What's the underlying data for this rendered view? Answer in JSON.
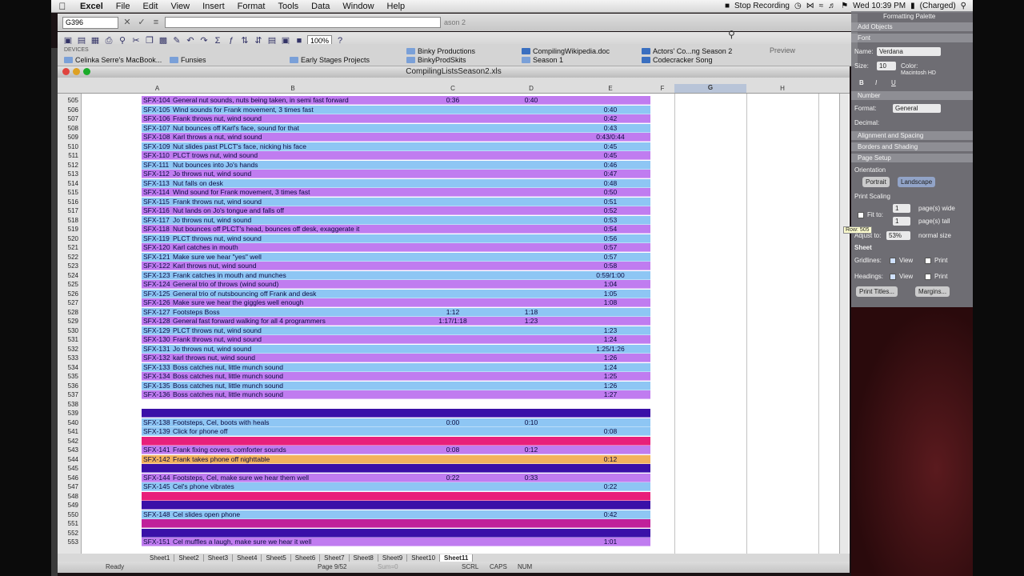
{
  "menubar": {
    "app": "Excel",
    "menus": [
      "File",
      "Edit",
      "View",
      "Insert",
      "Format",
      "Tools",
      "Data",
      "Window",
      "Help"
    ],
    "recording": "Stop Recording",
    "clock": "Wed 10:39 PM",
    "battery": "(Charged)"
  },
  "toolbar": {
    "namebox": "G396",
    "zoom": "100%",
    "partial_tab": "ason 2"
  },
  "bookmarks": {
    "devices": "DEVICES",
    "macbook": "Celinka Serre's MacBook...",
    "items": [
      "Funsies",
      "Early Stages Projects",
      "BinkyProdSkits",
      "Season 1",
      "Codecracker Song"
    ],
    "top_items": [
      "CompilingWikipedia.doc",
      "Actors' Co...ng Season 2"
    ],
    "partial": [
      "Binky Productions"
    ],
    "preview": "Preview"
  },
  "window": {
    "title": "CompilingListsSeason2.xls"
  },
  "columns": {
    "A": "A",
    "B": "B",
    "C": "C",
    "D": "D",
    "E": "E",
    "F": "F",
    "G": "G",
    "H": "H"
  },
  "rows": [
    {
      "n": "505",
      "a": "SFX-104",
      "b": "General nut sounds, nuts being taken, in semi fast forward",
      "c": "0:36",
      "d": "0:40",
      "e": "",
      "color": "#c07cf0"
    },
    {
      "n": "506",
      "a": "SFX-105",
      "b": "Wind sounds for Frank movement, 3 times fast",
      "c": "",
      "d": "",
      "e": "0:40",
      "color": "#8ec6f4"
    },
    {
      "n": "507",
      "a": "SFX-106",
      "b": "Frank throws nut, wind sound",
      "c": "",
      "d": "",
      "e": "0:42",
      "color": "#c07cf0"
    },
    {
      "n": "508",
      "a": "SFX-107",
      "b": "Nut bounces off Karl's face, sound for that",
      "c": "",
      "d": "",
      "e": "0:43",
      "color": "#8ec6f4"
    },
    {
      "n": "509",
      "a": "SFX-108",
      "b": "Karl throws a nut, wind sound",
      "c": "",
      "d": "",
      "e": "0:43/0:44",
      "color": "#c07cf0"
    },
    {
      "n": "510",
      "a": "SFX-109",
      "b": "Nut slides past PLCT's face, nicking his face",
      "c": "",
      "d": "",
      "e": "0:45",
      "color": "#8ec6f4"
    },
    {
      "n": "511",
      "a": "SFX-110",
      "b": "PLCT trows nut, wind sound",
      "c": "",
      "d": "",
      "e": "0:45",
      "color": "#c07cf0"
    },
    {
      "n": "512",
      "a": "SFX-111",
      "b": "Nut bounces into Jo's hands",
      "c": "",
      "d": "",
      "e": "0:46",
      "color": "#8ec6f4"
    },
    {
      "n": "513",
      "a": "SFX-112",
      "b": "Jo throws nut, wind sound",
      "c": "",
      "d": "",
      "e": "0:47",
      "color": "#c07cf0"
    },
    {
      "n": "514",
      "a": "SFX-113",
      "b": "Nut falls on desk",
      "c": "",
      "d": "",
      "e": "0:48",
      "color": "#8ec6f4"
    },
    {
      "n": "515",
      "a": "SFX-114",
      "b": "Wind sound for Frank movement, 3 times fast",
      "c": "",
      "d": "",
      "e": "0:50",
      "color": "#c07cf0"
    },
    {
      "n": "516",
      "a": "SFX-115",
      "b": "Frank throws nut, wind sound",
      "c": "",
      "d": "",
      "e": "0:51",
      "color": "#8ec6f4"
    },
    {
      "n": "517",
      "a": "SFX-116",
      "b": "Nut lands on Jo's tongue and falls off",
      "c": "",
      "d": "",
      "e": "0:52",
      "color": "#c07cf0"
    },
    {
      "n": "518",
      "a": "SFX-117",
      "b": "Jo throws nut, wind sound",
      "c": "",
      "d": "",
      "e": "0:53",
      "color": "#8ec6f4"
    },
    {
      "n": "519",
      "a": "SFX-118",
      "b": "Nut bounces off PLCT's head, bounces off desk, exaggerate it",
      "c": "",
      "d": "",
      "e": "0:54",
      "color": "#c07cf0"
    },
    {
      "n": "520",
      "a": "SFX-119",
      "b": "PLCT throws nut, wind sound",
      "c": "",
      "d": "",
      "e": "0:56",
      "color": "#8ec6f4"
    },
    {
      "n": "521",
      "a": "SFX-120",
      "b": "Karl catches in mouth",
      "c": "",
      "d": "",
      "e": "0:57",
      "color": "#c07cf0"
    },
    {
      "n": "522",
      "a": "SFX-121",
      "b": "Make sure we hear \"yes\" well",
      "c": "",
      "d": "",
      "e": "0:57",
      "color": "#8ec6f4"
    },
    {
      "n": "523",
      "a": "SFX-122",
      "b": "Karl throws nut, wind sound",
      "c": "",
      "d": "",
      "e": "0:58",
      "color": "#c07cf0"
    },
    {
      "n": "524",
      "a": "SFX-123",
      "b": "Frank catches in mouth and munches",
      "c": "",
      "d": "",
      "e": "0:59/1:00",
      "color": "#8ec6f4"
    },
    {
      "n": "525",
      "a": "SFX-124",
      "b": "General trio of throws (wind sound)",
      "c": "",
      "d": "",
      "e": "1:04",
      "color": "#c07cf0"
    },
    {
      "n": "526",
      "a": "SFX-125",
      "b": "General trio of nutsbouncing off Frank and desk",
      "c": "",
      "d": "",
      "e": "1:05",
      "color": "#8ec6f4"
    },
    {
      "n": "527",
      "a": "SFX-126",
      "b": "Make sure we hear the giggles well enough",
      "c": "",
      "d": "",
      "e": "1:08",
      "color": "#c07cf0"
    },
    {
      "n": "528",
      "a": "SFX-127",
      "b": "Footsteps Boss",
      "c": "1:12",
      "d": "1:18",
      "e": "",
      "color": "#8ec6f4"
    },
    {
      "n": "529",
      "a": "SFX-128",
      "b": "General fast forward walking for all 4 programmers",
      "c": "1:17/1:18",
      "d": "1:23",
      "e": "",
      "color": "#c07cf0"
    },
    {
      "n": "530",
      "a": "SFX-129",
      "b": "PLCT throws nut, wind sound",
      "c": "",
      "d": "",
      "e": "1:23",
      "color": "#8ec6f4"
    },
    {
      "n": "531",
      "a": "SFX-130",
      "b": "Frank throws nut, wind sound",
      "c": "",
      "d": "",
      "e": "1:24",
      "color": "#c07cf0"
    },
    {
      "n": "532",
      "a": "SFX-131",
      "b": "Jo throws nut, wind sound",
      "c": "",
      "d": "",
      "e": "1:25/1:26",
      "color": "#8ec6f4"
    },
    {
      "n": "533",
      "a": "SFX-132",
      "b": "karl throws nut, wind sound",
      "c": "",
      "d": "",
      "e": "1:26",
      "color": "#c07cf0"
    },
    {
      "n": "534",
      "a": "SFX-133",
      "b": "Boss catches nut, little munch sound",
      "c": "",
      "d": "",
      "e": "1:24",
      "color": "#8ec6f4"
    },
    {
      "n": "535",
      "a": "SFX-134",
      "b": "Boss catches nut, little munch sound",
      "c": "",
      "d": "",
      "e": "1:25",
      "color": "#c07cf0"
    },
    {
      "n": "536",
      "a": "SFX-135",
      "b": "Boss catches nut, little munch sound",
      "c": "",
      "d": "",
      "e": "1:26",
      "color": "#8ec6f4"
    },
    {
      "n": "537",
      "a": "SFX-136",
      "b": "Boss catches nut, little munch sound",
      "c": "",
      "d": "",
      "e": "1:27",
      "color": "#c07cf0"
    },
    {
      "n": "538",
      "a": "",
      "b": "",
      "c": "",
      "d": "",
      "e": "",
      "color": "#ffffff"
    },
    {
      "n": "539",
      "a": "",
      "b": "",
      "c": "",
      "d": "",
      "e": "",
      "color": "#3a10a8"
    },
    {
      "n": "540",
      "a": "SFX-138",
      "b": "Footsteps, Cel, boots with heals",
      "c": "0:00",
      "d": "0:10",
      "e": "",
      "color": "#8ec6f4"
    },
    {
      "n": "541",
      "a": "SFX-139",
      "b": "Click for phone off",
      "c": "",
      "d": "",
      "e": "0:08",
      "color": "#8ec6f4"
    },
    {
      "n": "542",
      "a": "",
      "b": "",
      "c": "",
      "d": "",
      "e": "",
      "color": "#e8207a"
    },
    {
      "n": "543",
      "a": "SFX-141",
      "b": "Frank fixing covers, comforter sounds",
      "c": "0:08",
      "d": "0:12",
      "e": "",
      "color": "#c07cf0"
    },
    {
      "n": "544",
      "a": "SFX-142",
      "b": "Frank takes phone off nighttable",
      "c": "",
      "d": "",
      "e": "0:12",
      "color": "#f2b25e"
    },
    {
      "n": "545",
      "a": "",
      "b": "",
      "c": "",
      "d": "",
      "e": "",
      "color": "#3a10a8"
    },
    {
      "n": "546",
      "a": "SFX-144",
      "b": "Footsteps, Cel, make sure we hear them well",
      "c": "0:22",
      "d": "0:33",
      "e": "",
      "color": "#c07cf0"
    },
    {
      "n": "547",
      "a": "SFX-145",
      "b": "Cel's phone vibrates",
      "c": "",
      "d": "",
      "e": "0:22",
      "color": "#8ec6f4"
    },
    {
      "n": "548",
      "a": "",
      "b": "",
      "c": "",
      "d": "",
      "e": "",
      "color": "#e8207a"
    },
    {
      "n": "549",
      "a": "",
      "b": "",
      "c": "",
      "d": "",
      "e": "",
      "color": "#3a10a8"
    },
    {
      "n": "550",
      "a": "SFX-148",
      "b": "Cel slides open phone",
      "c": "",
      "d": "",
      "e": "0:42",
      "color": "#8ec6f4"
    },
    {
      "n": "551",
      "a": "",
      "b": "",
      "c": "",
      "d": "",
      "e": "",
      "color": "#c0209a"
    },
    {
      "n": "552",
      "a": "",
      "b": "",
      "c": "",
      "d": "",
      "e": "",
      "color": "#3a10a8"
    },
    {
      "n": "553",
      "a": "SFX-151",
      "b": "Cel muffles a laugh, make sure we hear it well",
      "c": "",
      "d": "",
      "e": "1:01",
      "color": "#c07cf0"
    }
  ],
  "sheets": [
    "Sheet1",
    "Sheet2",
    "Sheet3",
    "Sheet4",
    "Sheet5",
    "Sheet6",
    "Sheet7",
    "Sheet8",
    "Sheet9",
    "Sheet10",
    "Sheet11"
  ],
  "status": {
    "ready": "Ready",
    "page": "Page 9/52",
    "sum": "Sum=0",
    "scrl": "SCRL",
    "caps": "CAPS",
    "num": "NUM"
  },
  "palette": {
    "title": "Formatting Palette",
    "add_objects": "Add Objects",
    "font": "Font",
    "name_label": "Name:",
    "name_value": "Verdana",
    "size_label": "Size:",
    "size_value": "10",
    "color_label": "Color:",
    "hd": "Macintosh HD",
    "number": "Number",
    "format_label": "Format:",
    "format_value": "General",
    "decimal": "Decimal:",
    "align": "Alignment and Spacing",
    "borders": "Borders and Shading",
    "page_setup": "Page Setup",
    "orientation": "Orientation",
    "portrait": "Portrait",
    "landscape": "Landscape",
    "print_scaling": "Print Scaling",
    "fit_to": "Fit to:",
    "fit_wide_value": "1",
    "fit_wide": "page(s) wide",
    "fit_tall_value": "1",
    "fit_tall": "page(s) tall",
    "adjust": "Adjust to:",
    "adjust_value": "53%",
    "normal": "normal size",
    "sheet": "Sheet",
    "gridlines": "Gridlines:",
    "view": "View",
    "print": "Print",
    "headings": "Headings:",
    "print_titles": "Print Titles...",
    "margins": "Margins..."
  },
  "tooltip": "Row: 505"
}
